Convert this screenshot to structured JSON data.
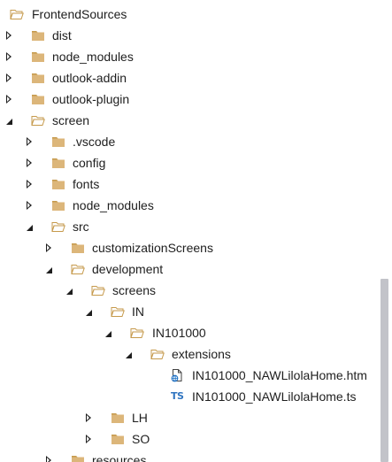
{
  "solution_explorer": {
    "rows": [
      {
        "label": "FrontendSources",
        "expander": "none",
        "icon": "folder-open"
      },
      {
        "label": "dist",
        "expander": "collapsed",
        "icon": "folder-closed"
      },
      {
        "label": "node_modules",
        "expander": "collapsed",
        "icon": "folder-closed"
      },
      {
        "label": "outlook-addin",
        "expander": "collapsed",
        "icon": "folder-closed"
      },
      {
        "label": "outlook-plugin",
        "expander": "collapsed",
        "icon": "folder-closed"
      },
      {
        "label": "screen",
        "expander": "expanded",
        "icon": "folder-open"
      },
      {
        "label": ".vscode",
        "expander": "collapsed",
        "icon": "folder-closed"
      },
      {
        "label": "config",
        "expander": "collapsed",
        "icon": "folder-closed"
      },
      {
        "label": "fonts",
        "expander": "collapsed",
        "icon": "folder-closed"
      },
      {
        "label": "node_modules",
        "expander": "collapsed",
        "icon": "folder-closed"
      },
      {
        "label": "src",
        "expander": "expanded",
        "icon": "folder-open"
      },
      {
        "label": "customizationScreens",
        "expander": "collapsed",
        "icon": "folder-closed"
      },
      {
        "label": "development",
        "expander": "expanded",
        "icon": "folder-open"
      },
      {
        "label": "screens",
        "expander": "expanded",
        "icon": "folder-open"
      },
      {
        "label": "IN",
        "expander": "expanded",
        "icon": "folder-open"
      },
      {
        "label": "IN101000",
        "expander": "expanded",
        "icon": "folder-open"
      },
      {
        "label": "extensions",
        "expander": "expanded",
        "icon": "folder-open"
      },
      {
        "label": "IN101000_NAWLilolaHome.htm",
        "expander": "none",
        "icon": "html-file-icon"
      },
      {
        "label": "IN101000_NAWLilolaHome.ts",
        "expander": "none",
        "icon": "typescript-file-icon",
        "icon_text": "TS"
      },
      {
        "label": "LH",
        "expander": "collapsed",
        "icon": "folder-closed"
      },
      {
        "label": "SO",
        "expander": "collapsed",
        "icon": "folder-closed"
      },
      {
        "label": "resources",
        "expander": "collapsed",
        "icon": "folder-closed"
      }
    ]
  },
  "colors": {
    "folder_fill": "#dcb67a",
    "folder_tab": "#c69a4c",
    "text": "#1e1e1e",
    "ts_blue": "#2f74c0",
    "scrollbar_thumb": "#c2c3c9"
  }
}
